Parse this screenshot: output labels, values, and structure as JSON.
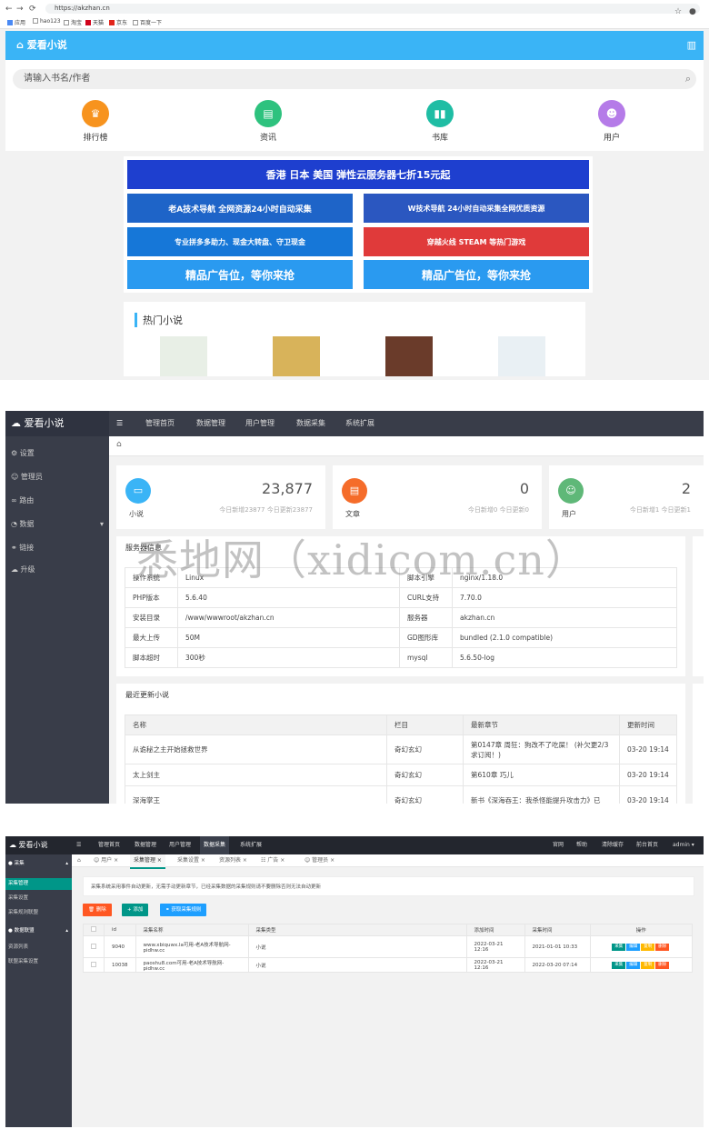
{
  "panel1": {
    "url": "https://akzhan.cn",
    "bookmarks": [
      "应用",
      "hao123",
      "淘宝",
      "天猫",
      "京东",
      "百度一下"
    ],
    "logo": "爱看小说",
    "search_placeholder": "请输入书名/作者",
    "quick_links": [
      {
        "label": "排行榜",
        "icon": "trophy-icon",
        "color": "#f7931e"
      },
      {
        "label": "资讯",
        "icon": "news-icon",
        "color": "#2ec27e"
      },
      {
        "label": "书库",
        "icon": "books-icon",
        "color": "#1fbda4"
      },
      {
        "label": "用户",
        "icon": "user-icon",
        "color": "#b57be8"
      }
    ],
    "ads": {
      "banner": "香港 日本 美国 弹性云服务器七折15元起",
      "a1": "老A技术导航 全网资源24小时自动采集",
      "a2": "W技术导航 24小时自动采集全网优质资源",
      "a3": "专业拼多多助力、现金大转盘、守卫现金",
      "a4": "穿越火线 STEAM 等热门游戏",
      "a5": "精品广告位，等你来抢",
      "a6": "精品广告位，等你来抢"
    },
    "hot_title": "热门小说"
  },
  "panel2": {
    "logo": "爱看小说",
    "sidebar": [
      "设置",
      "管理员",
      "路由",
      "数据",
      "链接",
      "升级"
    ],
    "topnav": [
      "管理首页",
      "数据管理",
      "用户管理",
      "数据采集",
      "系统扩展"
    ],
    "cards": [
      {
        "label": "小说",
        "num": "23,877",
        "sub": "今日新增23877 今日更新23877",
        "color": "#3ab4f6"
      },
      {
        "label": "文章",
        "num": "0",
        "sub": "今日新增0 今日更新0",
        "color": "#f56c2a"
      },
      {
        "label": "用户",
        "num": "2",
        "sub": "今日新增1 今日更新1",
        "color": "#5fb878"
      }
    ],
    "server_title": "服务器信息",
    "server_rows": [
      [
        "操作系统",
        "Linux",
        "脚本引擎",
        "nginx/1.18.0"
      ],
      [
        "PHP版本",
        "5.6.40",
        "CURL支持",
        "7.70.0"
      ],
      [
        "安装目录",
        "/www/wwwroot/akzhan.cn",
        "服务器",
        "akzhan.cn"
      ],
      [
        "最大上传",
        "50M",
        "GD图形库",
        "bundled (2.1.0 compatible)"
      ],
      [
        "脚本超时",
        "300秒",
        "mysql",
        "5.6.50-log"
      ]
    ],
    "recent_title": "最近更新小说",
    "recent_headers": [
      "名称",
      "栏目",
      "最新章节",
      "更新时间"
    ],
    "recent_rows": [
      [
        "从诡秘之主开始拯救世界",
        "奇幻玄幻",
        "第0147章 周狂：狗改不了吃屎！ (补欠更2/3求订阅！)",
        "03-20 19:14"
      ],
      [
        "太上剑主",
        "奇幻玄幻",
        "第610章 巧儿",
        "03-20 19:14"
      ],
      [
        "深海掌王",
        "奇幻玄幻",
        "新书《深海吞王：我杀怪能提升攻击力》已",
        "03-20 19:14"
      ]
    ],
    "watermark": "悉地网（xidicom.cn）"
  },
  "panel3": {
    "logo": "爱看小说",
    "topnav": [
      "管理首页",
      "数据管理",
      "用户管理",
      "数据采集",
      "系统扩展"
    ],
    "topright": [
      "官网",
      "帮助",
      "清除缓存",
      "前台首页",
      "admin"
    ],
    "sidebar": [
      "采集",
      "采集管理",
      "采集设置",
      "采集规则联盟",
      "数据联盟",
      "资源列表",
      "联盟采集设置"
    ],
    "tabs": [
      "用户",
      "采集管理",
      "采集设置",
      "资源列表",
      "广告",
      "管理员"
    ],
    "notice": "采集系统采用事件自动更新，无需手动更新章节，已经采集数据的采集规则请不要删除否则无法自动更新",
    "buttons": {
      "delete": "删除",
      "add": "添加",
      "fetch": "获取采集规则"
    },
    "headers": [
      "id",
      "采集名称",
      "采集类型",
      "添加时间",
      "采集时间",
      "操作"
    ],
    "rows": [
      {
        "id": "9040",
        "name": "www.xbiquwx.la可用-老A技术导航网-pidhw.cc",
        "type": "小说",
        "added": "2022-03-21 12:16",
        "collected": "2021-01-01 10:33"
      },
      {
        "id": "10038",
        "name": "paoshu8.com可用-老A技术导航网-pidhw.cc",
        "type": "小说",
        "added": "2022-03-21 12:16",
        "collected": "2022-03-20 07:14"
      }
    ],
    "ops": [
      "采集",
      "编辑",
      "复制",
      "删除"
    ]
  }
}
